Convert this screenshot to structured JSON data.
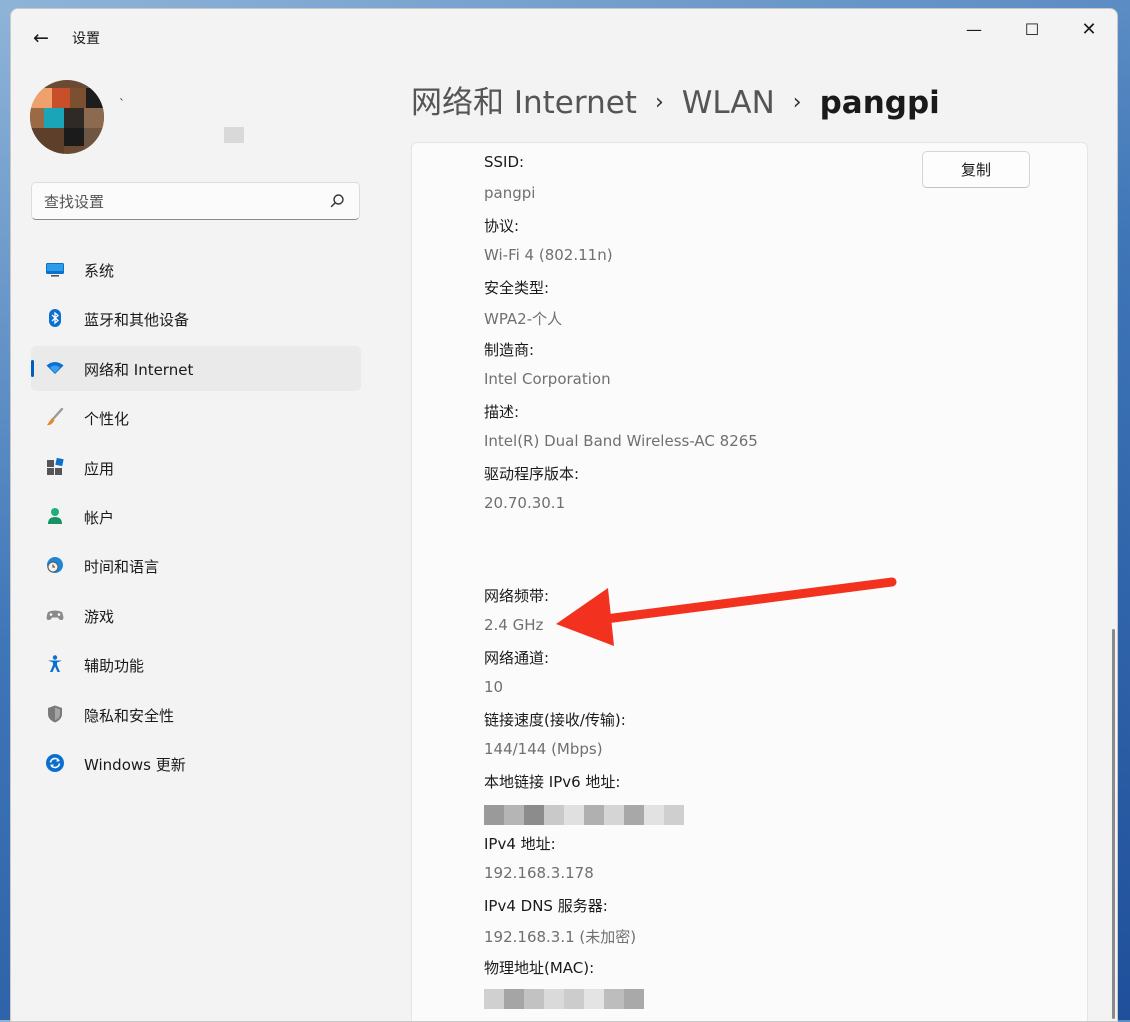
{
  "window": {
    "title": "设置",
    "controls": {
      "minimize": "—",
      "maximize": "☐",
      "close": "✕"
    }
  },
  "user": {
    "name_fragment": "`"
  },
  "search": {
    "placeholder": "查找设置"
  },
  "sidebar": {
    "items": [
      {
        "label": "系统",
        "icon": "monitor-icon",
        "active": false
      },
      {
        "label": "蓝牙和其他设备",
        "icon": "bluetooth-icon",
        "active": false
      },
      {
        "label": "网络和 Internet",
        "icon": "wifi-icon",
        "active": true
      },
      {
        "label": "个性化",
        "icon": "brush-icon",
        "active": false
      },
      {
        "label": "应用",
        "icon": "apps-icon",
        "active": false
      },
      {
        "label": "帐户",
        "icon": "person-icon",
        "active": false
      },
      {
        "label": "时间和语言",
        "icon": "globe-clock-icon",
        "active": false
      },
      {
        "label": "游戏",
        "icon": "gamepad-icon",
        "active": false
      },
      {
        "label": "辅助功能",
        "icon": "accessibility-icon",
        "active": false
      },
      {
        "label": "隐私和安全性",
        "icon": "shield-icon",
        "active": false
      },
      {
        "label": "Windows 更新",
        "icon": "update-icon",
        "active": false
      }
    ]
  },
  "breadcrumb": {
    "items": [
      "网络和 Internet",
      "WLAN"
    ],
    "current": "pangpi",
    "separator": "›"
  },
  "properties": {
    "copy_label": "复制",
    "ssid_label": "SSID:",
    "ssid_value": "pangpi",
    "protocol_label": "协议:",
    "protocol_value": "Wi-Fi 4 (802.11n)",
    "security_label": "安全类型:",
    "security_value": "WPA2-个人",
    "manufacturer_label": "制造商:",
    "manufacturer_value": "Intel Corporation",
    "description_label": "描述:",
    "description_value": "Intel(R) Dual Band Wireless-AC 8265",
    "driver_label": "驱动程序版本:",
    "driver_value": "20.70.30.1",
    "band_label": "网络频带:",
    "band_value": "2.4 GHz",
    "channel_label": "网络通道:",
    "channel_value": "10",
    "speed_label": "链接速度(接收/传输):",
    "speed_value": "144/144 (Mbps)",
    "ipv6_label": "本地链接 IPv6 地址:",
    "ipv4_label": "IPv4 地址:",
    "ipv4_value": "192.168.3.178",
    "dns_label": "IPv4 DNS 服务器:",
    "dns_value": "192.168.3.1 (未加密)",
    "mac_label": "物理地址(MAC):"
  },
  "colors": {
    "accent": "#005fb8",
    "arrow": "#f2321e",
    "label_text": "#1a1a1a",
    "value_text": "#707070"
  }
}
